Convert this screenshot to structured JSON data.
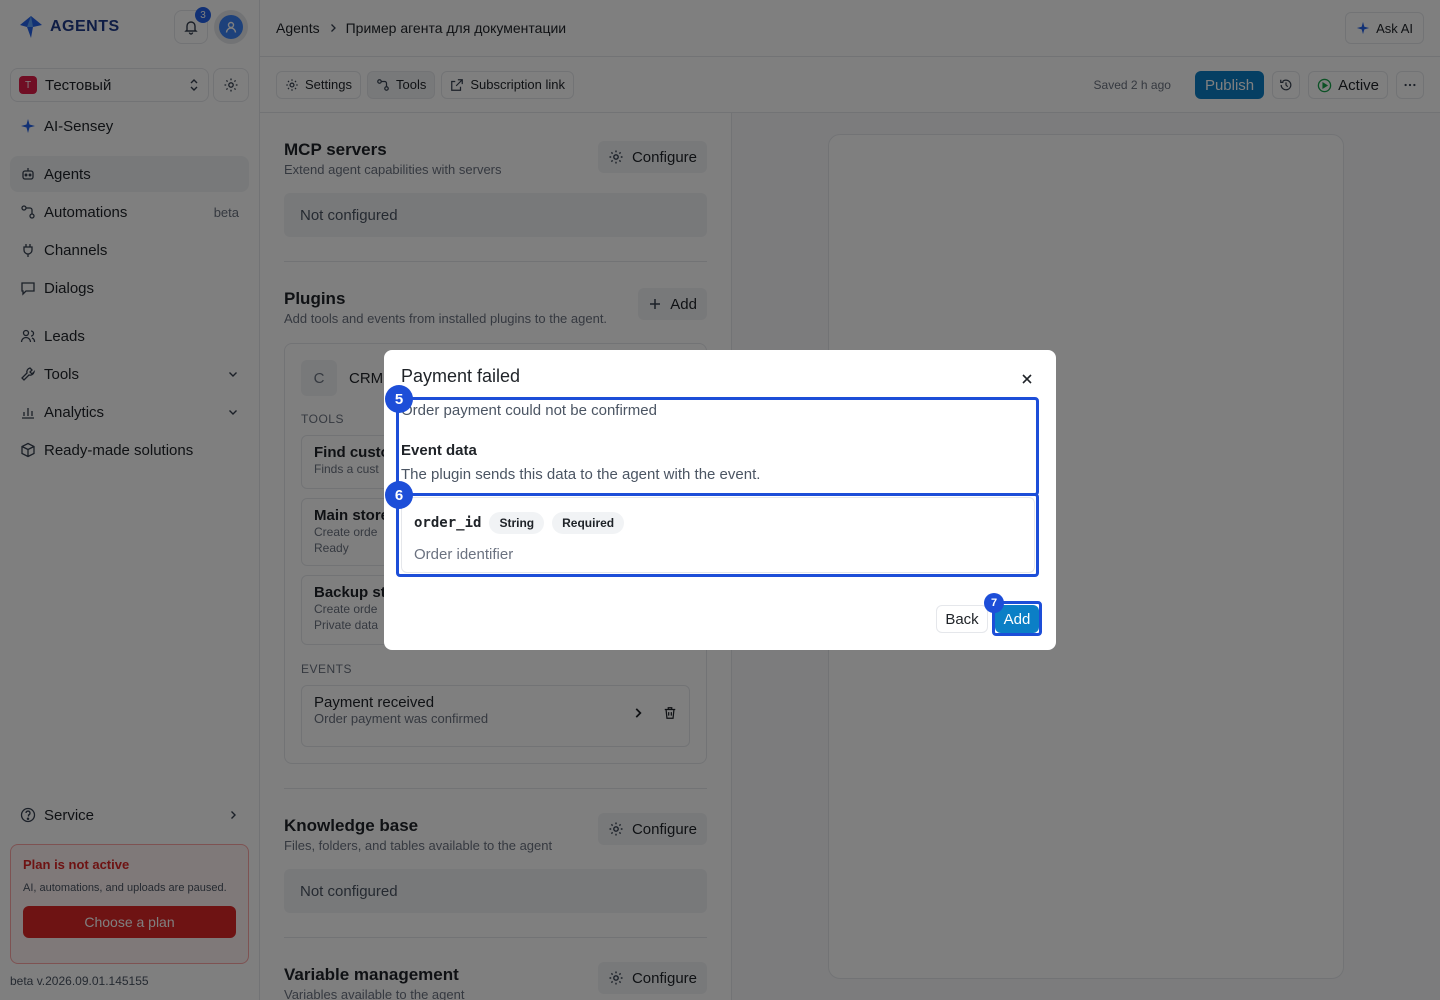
{
  "brand": {
    "name": "AGENTS"
  },
  "notifications": {
    "count": "3"
  },
  "workspace": {
    "badge": "T",
    "name": "Тестовый"
  },
  "nav": {
    "ai_sensey": "AI-Sensey",
    "agents": "Agents",
    "automations": "Automations",
    "automations_badge": "beta",
    "channels": "Channels",
    "dialogs": "Dialogs",
    "leads": "Leads",
    "tools": "Tools",
    "analytics": "Analytics",
    "ready_made": "Ready-made solutions",
    "service": "Service"
  },
  "plan": {
    "title": "Plan is not active",
    "desc": "AI, automations, and uploads are paused.",
    "button": "Choose a plan"
  },
  "version": "beta v.2026.09.01.145155",
  "breadcrumb": {
    "root": "Agents",
    "current": "Пример агента для документации"
  },
  "ask_ai": "Ask AI",
  "toolbar": {
    "settings": "Settings",
    "tools": "Tools",
    "subscription": "Subscription link",
    "saved": "Saved 2 h ago",
    "publish": "Publish",
    "active": "Active"
  },
  "mcp": {
    "title": "MCP servers",
    "subtitle": "Extend agent capabilities with servers",
    "button": "Configure",
    "empty": "Not configured"
  },
  "plugins": {
    "title": "Plugins",
    "subtitle": "Add tools and events from installed plugins to the agent.",
    "button": "Add",
    "card": {
      "letter": "C",
      "name": "CRM",
      "tools_label": "TOOLS",
      "events_label": "EVENTS",
      "tools": [
        {
          "title": "Find custo",
          "sub1": "Finds a cust",
          "sub2": ""
        },
        {
          "title": "Main store",
          "sub1": "Create orde",
          "sub2": "Ready"
        },
        {
          "title": "Backup st",
          "sub1": "Create orde",
          "sub2": "Private data"
        }
      ],
      "event": {
        "title": "Payment received",
        "sub": "Order payment was confirmed"
      }
    }
  },
  "knowledge": {
    "title": "Knowledge base",
    "subtitle": "Files, folders, and tables available to the agent",
    "button": "Configure",
    "empty": "Not configured"
  },
  "variables": {
    "title": "Variable management",
    "subtitle": "Variables available to the agent",
    "button": "Configure"
  },
  "dialog": {
    "title": "Payment failed",
    "description": "Order payment could not be confirmed",
    "event_data_title": "Event data",
    "event_data_sub": "The plugin sends this data to the agent with the event.",
    "field": {
      "name": "order_id",
      "type": "String",
      "required": "Required",
      "description": "Order identifier"
    },
    "back": "Back",
    "add": "Add",
    "markers": {
      "m5": "5",
      "m6": "6",
      "m7": "7"
    }
  },
  "colors": {
    "accent": "#0b7fc6",
    "highlight": "#1d4ed8",
    "danger": "#dc2626"
  }
}
